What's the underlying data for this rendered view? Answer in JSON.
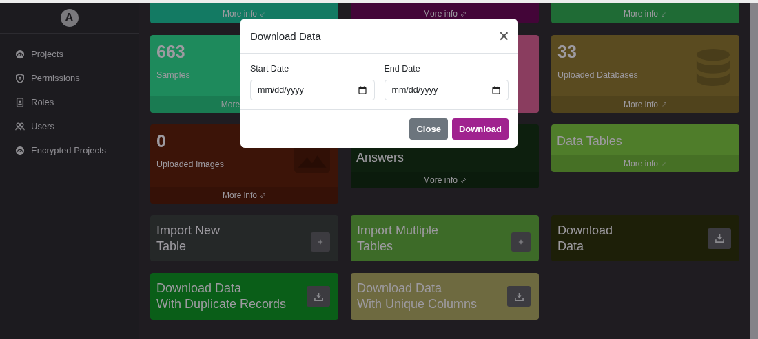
{
  "sidebar": {
    "logo": "A",
    "items": [
      {
        "label": "Projects"
      },
      {
        "label": "Permissions"
      },
      {
        "label": "Roles"
      },
      {
        "label": "Users"
      },
      {
        "label": "Encrypted Projects"
      }
    ]
  },
  "cards": [
    {
      "kind": "footer",
      "color": "#137a63",
      "footer": "More info"
    },
    {
      "kind": "footer",
      "color": "#430538",
      "footer": "More info"
    },
    {
      "kind": "footer",
      "color": "#1f6b35",
      "footer": "More info"
    },
    {
      "kind": "stat",
      "color": "#1e8a5c",
      "value": "663",
      "label": "Samples",
      "footer": "More"
    },
    {
      "kind": "blank",
      "color": "#8a3d5f"
    },
    {
      "kind": "stat",
      "color": "#5a4b20",
      "value": "33",
      "label": "Uploaded Databases",
      "footer": "More info"
    },
    {
      "kind": "stat",
      "color": "#3c1408",
      "value": "0",
      "label": "Uploaded Images",
      "footer": "More info"
    },
    {
      "kind": "title",
      "color": "#0d1f0e",
      "title": "Answers",
      "footer": "More info"
    },
    {
      "kind": "title",
      "color": "#4f7d2a",
      "title": "Data Tables",
      "footer": "More info"
    },
    {
      "kind": "action",
      "color": "#252828",
      "lines": [
        "Import New",
        "Table"
      ]
    },
    {
      "kind": "action",
      "color": "#3d6b28",
      "lines": [
        "Import Mutliple",
        "Tables"
      ]
    },
    {
      "kind": "action",
      "color": "#1d1f08",
      "lines": [
        "Download",
        "Data"
      ]
    },
    {
      "kind": "action",
      "color": "#0a5e18",
      "lines": [
        "Download Data",
        "With Duplicate Records"
      ]
    },
    {
      "kind": "action",
      "color": "#6e6a40",
      "lines": [
        "Download Data",
        "With Unique Columns"
      ]
    }
  ],
  "modal": {
    "title": "Download Data",
    "close": "×",
    "fields": [
      {
        "label": "Start Date",
        "placeholder": "mm/dd/yyyy"
      },
      {
        "label": "End Date",
        "placeholder": "mm/dd/yyyy"
      }
    ],
    "buttons": [
      {
        "label": "Close",
        "kind": "secondary"
      },
      {
        "label": "Download",
        "kind": "primary"
      }
    ]
  }
}
